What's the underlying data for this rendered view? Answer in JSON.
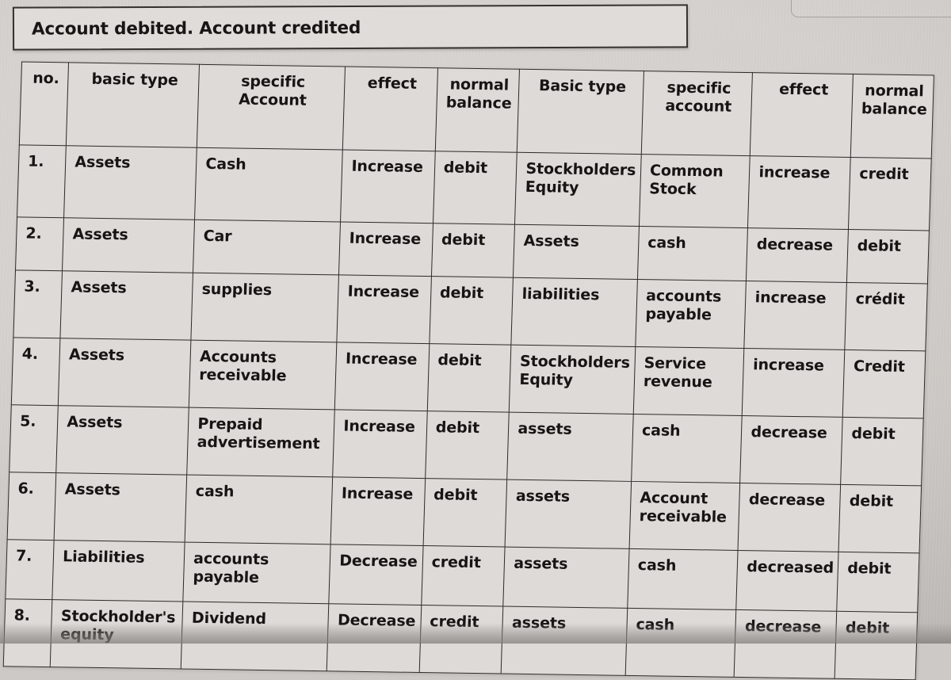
{
  "prompt": {
    "text": "Account debited. Account credited"
  },
  "table": {
    "headers": [
      "no.",
      "basic type",
      "specific\nAccount",
      "effect",
      "normal\nbalance",
      "Basic type",
      "specific\naccount",
      "effect",
      "normal\nbalance"
    ],
    "headers_flat": {
      "no": "no.",
      "basic_type_debit": "basic type",
      "specific_account_debit": "specific Account",
      "effect_debit": "effect",
      "normal_balance_debit": "normal balance",
      "basic_type_credit": "Basic type",
      "specific_account_credit": "specific account",
      "effect_credit": "effect",
      "normal_balance_credit": "normal balance"
    },
    "rows": [
      {
        "no": "1.",
        "basic_type_debit": "Assets",
        "specific_account_debit": "Cash",
        "effect_debit": "Increase",
        "normal_balance_debit": "debit",
        "basic_type_credit": "Stockholders Equity",
        "specific_account_credit": "Common Stock",
        "effect_credit": "increase",
        "normal_balance_credit": "credit"
      },
      {
        "no": "2.",
        "basic_type_debit": "Assets",
        "specific_account_debit": "Car",
        "effect_debit": "Increase",
        "normal_balance_debit": "debit",
        "basic_type_credit": "Assets",
        "specific_account_credit": "cash",
        "effect_credit": "decrease",
        "normal_balance_credit": "debit"
      },
      {
        "no": "3.",
        "basic_type_debit": "Assets",
        "specific_account_debit": "supplies",
        "effect_debit": "Increase",
        "normal_balance_debit": "debit",
        "basic_type_credit": "liabilities",
        "specific_account_credit": "accounts payable",
        "effect_credit": "increase",
        "normal_balance_credit": "crédit"
      },
      {
        "no": "4.",
        "basic_type_debit": "Assets",
        "specific_account_debit": "Accounts receivable",
        "effect_debit": "Increase",
        "normal_balance_debit": "debit",
        "basic_type_credit": "Stockholders Equity",
        "specific_account_credit": "Service revenue",
        "effect_credit": "increase",
        "normal_balance_credit": "Credit"
      },
      {
        "no": "5.",
        "basic_type_debit": "Assets",
        "specific_account_debit": "Prepaid advertisement",
        "effect_debit": "Increase",
        "normal_balance_debit": "debit",
        "basic_type_credit": "assets",
        "specific_account_credit": "cash",
        "effect_credit": "decrease",
        "normal_balance_credit": "debit"
      },
      {
        "no": "6.",
        "basic_type_debit": "Assets",
        "specific_account_debit": "cash",
        "effect_debit": "Increase",
        "normal_balance_debit": "debit",
        "basic_type_credit": "assets",
        "specific_account_credit": "Account receivable",
        "effect_credit": "decrease",
        "normal_balance_credit": "debit"
      },
      {
        "no": "7.",
        "basic_type_debit": "Liabilities",
        "specific_account_debit": "accounts payable",
        "effect_debit": "Decrease",
        "normal_balance_debit": "credit",
        "basic_type_credit": "assets",
        "specific_account_credit": "cash",
        "effect_credit": "decreased",
        "normal_balance_credit": "debit"
      },
      {
        "no": "8.",
        "basic_type_debit": "Stockholder's equity",
        "specific_account_debit": "Dividend",
        "effect_debit": "Decrease",
        "normal_balance_debit": "credit",
        "basic_type_credit": "assets",
        "specific_account_credit": "cash",
        "effect_credit": "decrease",
        "normal_balance_credit": "debit"
      }
    ]
  },
  "colors": {
    "paper": "#dedad7",
    "ink": "#171514",
    "rule": "#2c2a29",
    "background": "#cdc9c6"
  }
}
